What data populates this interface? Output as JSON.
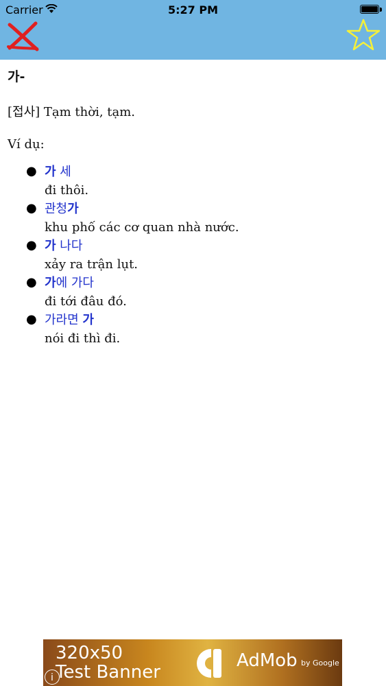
{
  "status_bar": {
    "carrier": "Carrier",
    "time": "5:27 PM",
    "battery_level": 1.0
  },
  "toolbar": {
    "close_icon": "close-icon",
    "favorite_icon": "star-icon",
    "colors": {
      "bar": "#70b5e2",
      "close": "#e02020",
      "star": "#f5f03a"
    }
  },
  "entry": {
    "headword": "가-",
    "definition": "[접사] Tạm thời, tạm.",
    "examples_label": "Ví dụ:",
    "examples": [
      {
        "ko_parts": [
          {
            "text": "가",
            "bold": true
          },
          {
            "text": " 세",
            "bold": false
          }
        ],
        "vi": "đi thôi."
      },
      {
        "ko_parts": [
          {
            "text": "관청",
            "bold": false
          },
          {
            "text": "가",
            "bold": true
          }
        ],
        "vi": "khu phố các cơ quan nhà nước."
      },
      {
        "ko_parts": [
          {
            "text": "가",
            "bold": true
          },
          {
            "text": " 나다",
            "bold": false
          }
        ],
        "vi": "xảy ra trận lụt."
      },
      {
        "ko_parts": [
          {
            "text": "가",
            "bold": true
          },
          {
            "text": "에 가다",
            "bold": false
          }
        ],
        "vi": "đi tới đâu đó."
      },
      {
        "ko_parts": [
          {
            "text": "가라면 ",
            "bold": false
          },
          {
            "text": "가",
            "bold": true
          }
        ],
        "vi": "nói đi thì đi."
      }
    ]
  },
  "ad": {
    "size_text": "320x50",
    "name_text": "Test Banner",
    "brand": "AdMob",
    "by": "by Google",
    "info_icon": "info-icon"
  }
}
